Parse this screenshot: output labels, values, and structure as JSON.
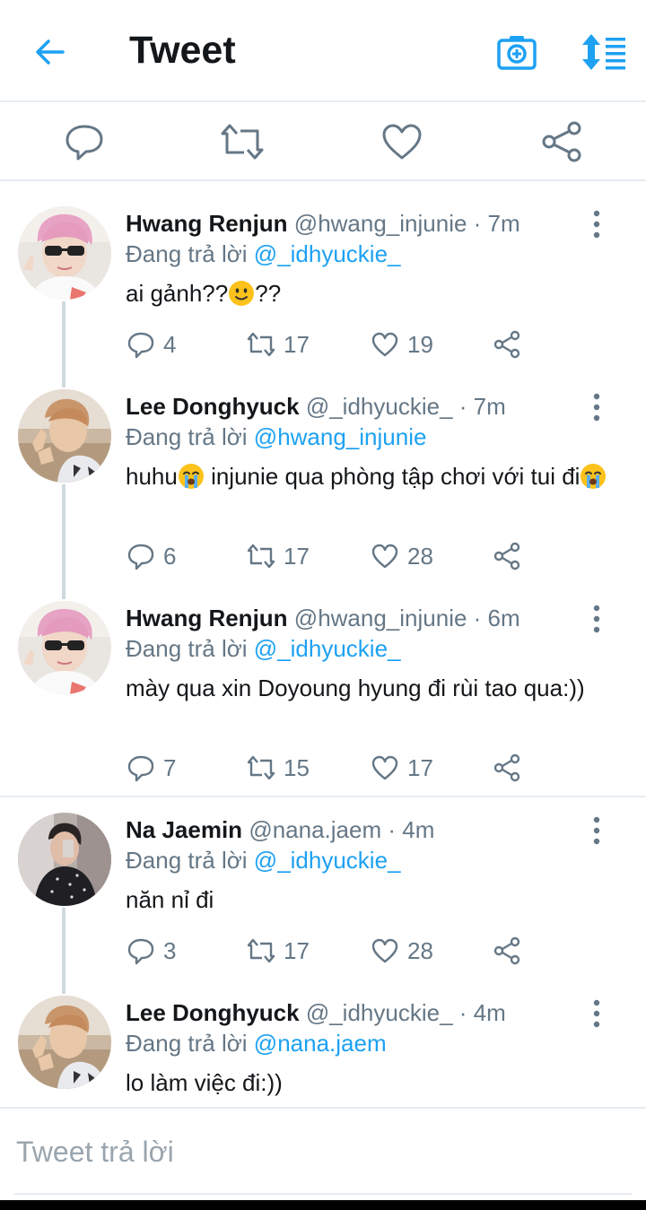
{
  "header": {
    "title": "Tweet"
  },
  "icons": {
    "back": "arrow-left-icon",
    "camera": "camera-plus-icon",
    "sort": "sort-icon",
    "reply": "reply-icon",
    "retweet": "retweet-icon",
    "like": "heart-icon",
    "share": "share-icon",
    "more": "more-vertical-icon"
  },
  "colors": {
    "accent": "#1da1f2",
    "muted": "#657786",
    "divider": "#e6ecf0"
  },
  "tweets": [
    {
      "name": "Hwang Renjun",
      "handle": "@hwang_injunie",
      "time": "· 7m",
      "reply_prefix": "Đang trả lời",
      "reply_to": "@_idhyuckie_",
      "text_a": "ai gảnh??",
      "emoji": "slightly-smiling-face",
      "text_b": "??",
      "replies": "4",
      "retweets": "17",
      "likes": "19"
    },
    {
      "name": "Lee Donghyuck",
      "handle": "@_idhyuckie_",
      "time": "· 7m",
      "reply_prefix": "Đang trả lời",
      "reply_to": "@hwang_injunie",
      "text_a": "huhu",
      "emoji": "loudly-crying-face",
      "text_b": " injunie qua phòng tập chơi với tui đi",
      "replies": "6",
      "retweets": "17",
      "likes": "28"
    },
    {
      "name": "Hwang Renjun",
      "handle": "@hwang_injunie",
      "time": "· 6m",
      "reply_prefix": "Đang trả lời",
      "reply_to": "@_idhyuckie_",
      "text_a": "mày qua xin Doyoung hyung đi rùi tao qua:))",
      "replies": "7",
      "retweets": "15",
      "likes": "17"
    },
    {
      "name": "Na Jaemin",
      "handle": "@nana.jaem",
      "time": "· 4m",
      "reply_prefix": "Đang trả lời",
      "reply_to": "@_idhyuckie_",
      "text_a": "năn nỉ đi",
      "replies": "3",
      "retweets": "17",
      "likes": "28"
    },
    {
      "name": "Lee Donghyuck",
      "handle": "@_idhyuckie_",
      "time": "· 4m",
      "reply_prefix": "Đang trả lời",
      "reply_to": "@nana.jaem",
      "text_a": "lo làm việc đi:))"
    }
  ],
  "composer": {
    "placeholder": "Tweet trả lời"
  }
}
